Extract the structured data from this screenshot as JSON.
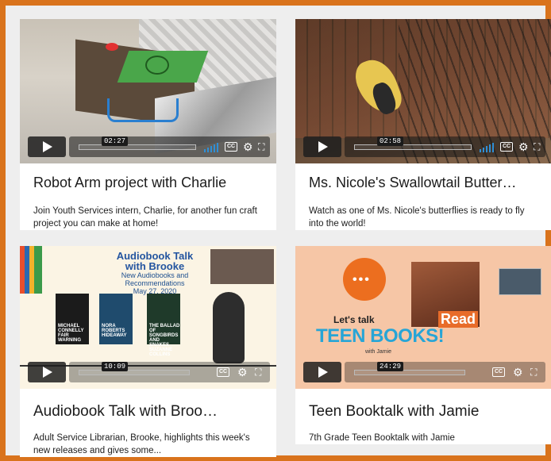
{
  "cards": [
    {
      "title": "Robot Arm project with Charlie",
      "description": "Join Youth Services intern, Charlie, for another fun craft project you can make at home!",
      "duration": "02:27"
    },
    {
      "title": "Ms. Nicole's Swallowtail Butter…",
      "description": "Watch as one of Ms. Nicole's butterflies is ready to fly into the world!",
      "duration": "02:58"
    },
    {
      "title": "Audiobook Talk with Broo…",
      "description": "Adult Service Librarian, Brooke, highlights this week's new releases and gives some...",
      "duration": "10:09",
      "thumbnail_text": {
        "heading": "Audiobook Talk with Brooke",
        "subheading": "New Audiobooks and Recommendations",
        "date": "May 27, 2020",
        "books": [
          "MICHAEL CONNELLY FAIR WARNING",
          "NORA ROBERTS HIDEAWAY",
          "THE BALLAD OF SONGBIRDS AND SNAKES SUZANNE COLLINS"
        ]
      }
    },
    {
      "title": "Teen Booktalk with Jamie",
      "description": "7th Grade Teen Booktalk with Jamie",
      "duration": "24:29",
      "thumbnail_text": {
        "lets_talk": "Let's talk",
        "teen_books": "TEEN BOOKS!",
        "with": "with Jamie",
        "read": "Read"
      }
    }
  ],
  "controls": {
    "cc_label": "CC",
    "settings_icon": "gear-icon",
    "fullscreen_icon": "fullscreen-icon",
    "play_icon": "play-icon",
    "volume_icon": "volume-icon"
  },
  "colors": {
    "frame_border": "#d9731c",
    "volume_bars": "#2f8fd6"
  }
}
